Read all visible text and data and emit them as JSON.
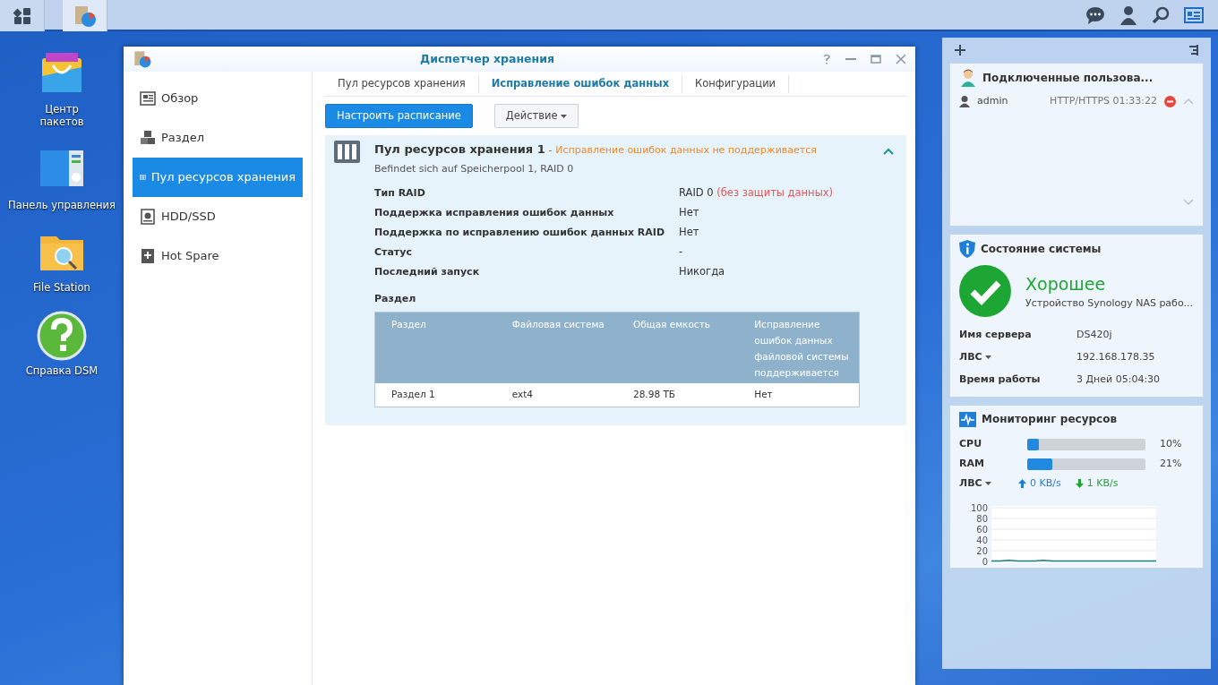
{
  "desktop_icons": [
    {
      "label": "Центр пакетов",
      "kind": "package"
    },
    {
      "label": "Панель управления",
      "kind": "control"
    },
    {
      "label": "File Station",
      "kind": "files"
    },
    {
      "label": "Справка DSM",
      "kind": "help"
    }
  ],
  "window": {
    "title": "Диспетчер хранения"
  },
  "sidebar": {
    "items": [
      {
        "label": "Обзор",
        "kind": "overview",
        "selected": false
      },
      {
        "label": "Раздел",
        "kind": "volume",
        "selected": false
      },
      {
        "label": "Пул ресурсов хранения",
        "kind": "pool",
        "selected": true
      },
      {
        "label": "HDD/SSD",
        "kind": "disk",
        "selected": false
      },
      {
        "label": "Hot Spare",
        "kind": "spare",
        "selected": false
      }
    ]
  },
  "tabs": [
    {
      "label": "Пул ресурсов хранения",
      "selected": false
    },
    {
      "label": "Исправление ошибок данных",
      "selected": true
    },
    {
      "label": "Конфигурации",
      "selected": false
    }
  ],
  "toolbar": {
    "buttons": [
      {
        "label": "Настроить расписание",
        "kind": "primary"
      },
      {
        "label": "Действие",
        "kind": "dropdown"
      }
    ]
  },
  "pool": {
    "title": "Пул ресурсов хранения 1",
    "separator": "-",
    "warning": "Исправление ошибок данных не поддерживается",
    "subtitle": "Befindet sich auf Speicherpool 1, RAID 0",
    "expanded": true,
    "properties": [
      {
        "label": "Тип RAID",
        "value": "RAID 0",
        "note": "(без защиты данных)"
      },
      {
        "label": "Поддержка исправления ошибок данных",
        "value": "Нет"
      },
      {
        "label": "Поддержка по исправлению ошибок данных RAID",
        "value": "Нет"
      },
      {
        "label": "Статус",
        "value": "-"
      },
      {
        "label": "Последний запуск",
        "value": "Никогда"
      }
    ],
    "section_title": "Раздел",
    "table": {
      "columns": [
        "Раздел",
        "Файловая система",
        "Общая емкость",
        "Исправление ошибок данных файловой системы поддерживается"
      ],
      "rows": [
        [
          "Раздел 1",
          "ext4",
          "28.98 ТБ",
          "Нет"
        ]
      ]
    }
  },
  "widgets": {
    "connected_users": {
      "title": "Подключенные пользова...",
      "users": [
        {
          "name": "admin",
          "connection": "HTTP/HTTPS 01:33:22"
        }
      ]
    },
    "system_health": {
      "title": "Состояние системы",
      "status": "Хорошее",
      "description": "Устройство Synology NAS рабо...",
      "rows": [
        {
          "label": "Имя сервера",
          "value": "DS420j",
          "dropdown": false
        },
        {
          "label": "ЛВС",
          "value": "192.168.178.35",
          "dropdown": true
        },
        {
          "label": "Время работы",
          "value": "3 Дней 05:04:30",
          "dropdown": false
        }
      ]
    },
    "resource_monitor": {
      "title": "Мониторинг ресурсов",
      "meters": [
        {
          "label": "CPU",
          "level": 0.1,
          "reading": "10%"
        },
        {
          "label": "RAM",
          "level": 0.21,
          "reading": "21%"
        }
      ],
      "network": {
        "label": "ЛВС",
        "upload": "0 KB/s",
        "download": "1 KB/s"
      },
      "chart_data": {
        "type": "line",
        "grid": true,
        "ylim": [
          0,
          100
        ],
        "yticks": [
          0,
          20,
          40,
          60,
          80,
          100
        ],
        "series": [
          {
            "color": "#1f7f86",
            "values": [
              1,
              1,
              2,
              1,
              1,
              1,
              2,
              1,
              1,
              1,
              1,
              1,
              1,
              1,
              1,
              1,
              1,
              1,
              1,
              1
            ]
          }
        ]
      }
    }
  }
}
